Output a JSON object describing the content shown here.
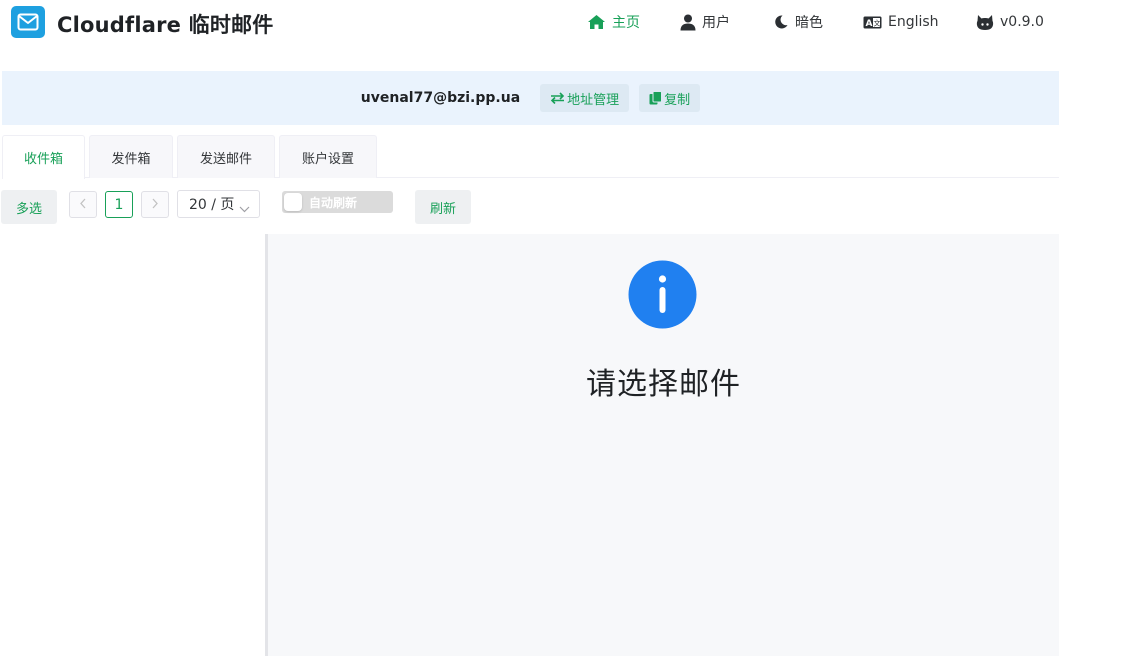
{
  "app": {
    "title": "Cloudflare 临时邮件",
    "icon": "mail-icon",
    "brand_color": "#1ea0e0",
    "accent_color": "#18a058"
  },
  "nav": [
    {
      "label": "主页",
      "icon": "home-icon",
      "active": true
    },
    {
      "label": "用户",
      "icon": "user-icon",
      "active": false
    },
    {
      "label": "暗色",
      "icon": "moon-icon",
      "active": false
    },
    {
      "label": "English",
      "icon": "translate-icon",
      "active": false
    },
    {
      "label": "v0.9.0",
      "icon": "github-icon",
      "active": false
    }
  ],
  "address": {
    "email": "uvenal77@bzi.pp.ua",
    "manage_label": "地址管理",
    "copy_label": "复制"
  },
  "tabs": [
    {
      "label": "收件箱",
      "active": true
    },
    {
      "label": "发件箱",
      "active": false
    },
    {
      "label": "发送邮件",
      "active": false
    },
    {
      "label": "账户设置",
      "active": false
    }
  ],
  "toolbar": {
    "multi_select_label": "多选",
    "current_page": "1",
    "page_size": "20 / 页",
    "auto_refresh_label": "自动刷新",
    "auto_refresh_on": false,
    "refresh_label": "刷新"
  },
  "detail": {
    "empty_icon": "info-icon",
    "empty_text": "请选择邮件",
    "icon_color": "#2080f0"
  }
}
